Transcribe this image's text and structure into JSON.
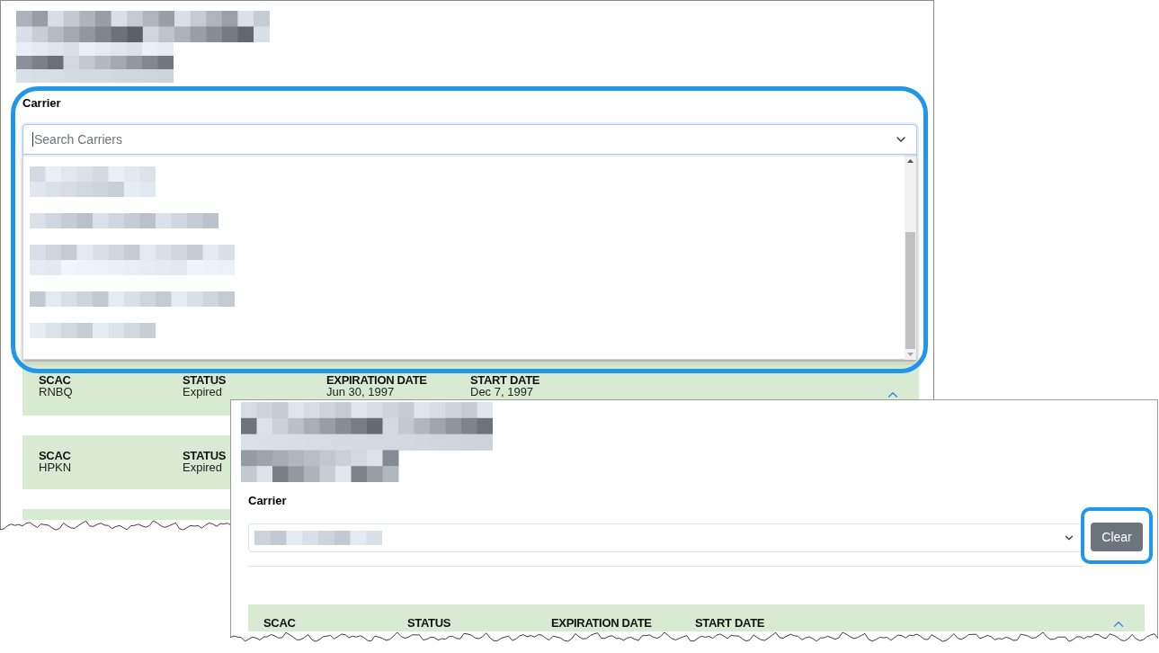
{
  "screens": [
    {
      "carrier": {
        "label": "Carrier",
        "placeholder": "Search Carriers",
        "expanded": true,
        "highlighted": true
      },
      "results": [
        {
          "fields": [
            {
              "label": "SCAC",
              "value": "RNBQ"
            },
            {
              "label": "STATUS",
              "value": "Expired"
            },
            {
              "label": "EXPIRATION DATE",
              "value": "Jun 30, 1997"
            },
            {
              "label": "START DATE",
              "value": "Dec 7, 1997"
            }
          ],
          "expanded": true
        },
        {
          "fields": [
            {
              "label": "SCAC",
              "value": "HPKN"
            },
            {
              "label": "STATUS",
              "value": "Expired"
            }
          ]
        }
      ]
    },
    {
      "carrier": {
        "label": "Carrier",
        "expanded": false,
        "clear_button": {
          "label": "Clear",
          "highlighted": true
        }
      },
      "results": [
        {
          "fields": [
            {
              "label": "SCAC"
            },
            {
              "label": "STATUS"
            },
            {
              "label": "EXPIRATION DATE"
            },
            {
              "label": "START DATE"
            }
          ],
          "expanded": true
        }
      ]
    }
  ]
}
